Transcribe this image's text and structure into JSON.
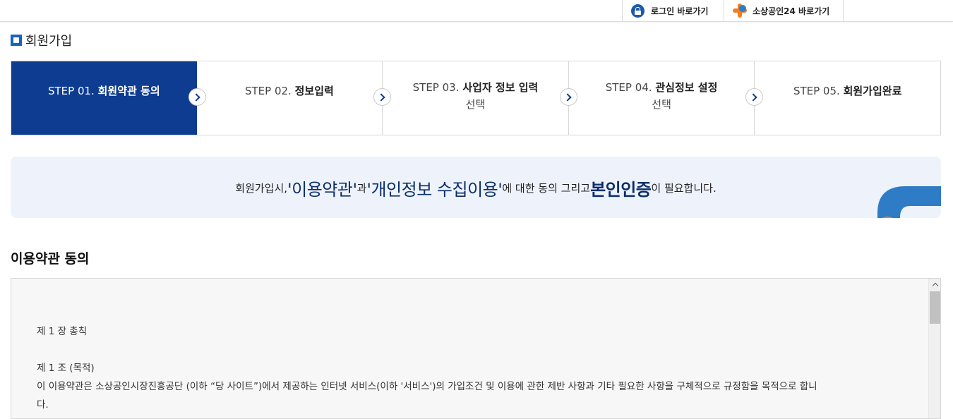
{
  "topbar": {
    "login_label": "로그인 바로가기",
    "sbiz_label": "소상공인24 바로가기"
  },
  "page": {
    "title": "회원가입"
  },
  "steps": [
    {
      "num": "STEP 01.",
      "name": "회원약관 동의",
      "sub": "",
      "active": true
    },
    {
      "num": "STEP 02.",
      "name": "정보입력",
      "sub": "",
      "active": false
    },
    {
      "num": "STEP 03.",
      "name": "사업자 정보 입력",
      "sub": "선택",
      "active": false
    },
    {
      "num": "STEP 04.",
      "name": "관심정보 설정",
      "sub": "선택",
      "active": false
    },
    {
      "num": "STEP 05.",
      "name": "회원가입완료",
      "sub": "",
      "active": false
    }
  ],
  "banner": {
    "prefix": "회원가입시, ",
    "term1": "'이용약관'",
    "conj1": "과 ",
    "term2": "'개인정보 수집이용'",
    "conj2": "에 대한 동의 그리고 ",
    "term3": "본인인증",
    "suffix": "이 필요합니다."
  },
  "section": {
    "title": "이용약관 동의"
  },
  "terms": {
    "chapter": "제 1 장 총칙",
    "article_title": "제 1 조 (목적)",
    "article_body_1": "이 이용약관은 소상공인시장진흥공단 (이하 “당 사이트”)에서 제공하는 인터넷 서비스(이하 '서비스')의 가입조건 및 이용에 관한 제반 사항과 기타 필요한 사항을 구체적으로 규정함을 목적으로 합니",
    "article_body_2": "다."
  },
  "colors": {
    "active_step": "#0d3c91",
    "banner_bg": "#eef3fb",
    "banner_emphasis": "#0b2e6b",
    "accent_orange": "#f07e22",
    "accent_blue": "#2e7cc6"
  }
}
